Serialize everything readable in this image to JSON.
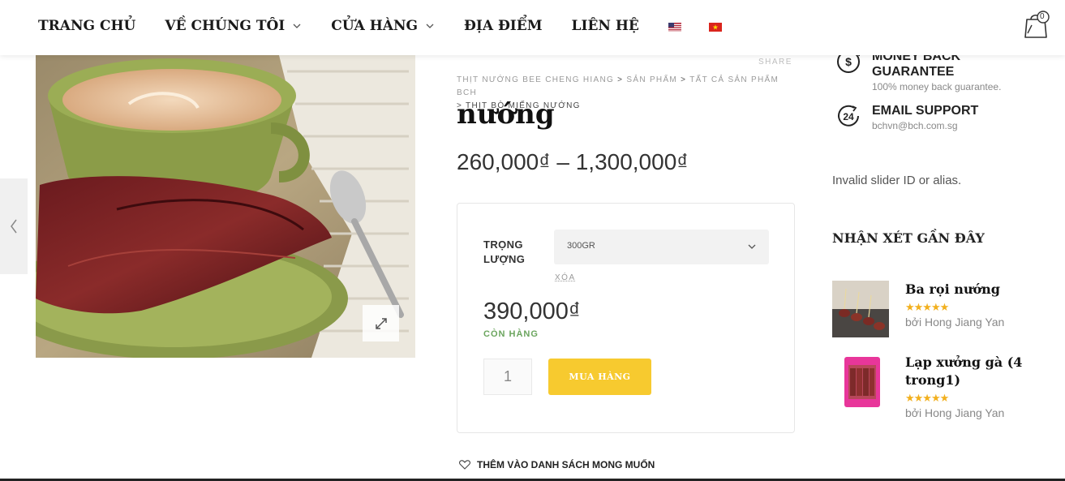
{
  "nav": {
    "items": [
      {
        "label": "TRANG CHỦ",
        "has_dropdown": false
      },
      {
        "label": "VỀ CHÚNG TÔI",
        "has_dropdown": true
      },
      {
        "label": "CỬA HÀNG",
        "has_dropdown": true
      },
      {
        "label": "ĐỊA ĐIỂM",
        "has_dropdown": false
      },
      {
        "label": "LIÊN HỆ",
        "has_dropdown": false
      }
    ],
    "flags": [
      "us-flag-icon",
      "vn-flag-icon"
    ],
    "cart_count": "0"
  },
  "product": {
    "share_label": "SHARE",
    "breadcrumb": [
      "THỊT NƯỚNG BEE CHENG HIANG",
      "SẢN PHẨM",
      "TẤT CẢ SẢN PHẨM BCH",
      "THỊT BÒ MIẾNG NƯỚNG"
    ],
    "breadcrumb_sep": ">",
    "title": "nướng",
    "price_range": "260,000₫ – 1,300,000₫"
  },
  "variation": {
    "attribute_label": "TRỌNG LƯỢNG",
    "selected": "300GR",
    "reset_label": "XÓA",
    "price": "390,000₫",
    "stock": "CÒN HÀNG",
    "quantity": "1",
    "buy_label": "MUA HÀNG"
  },
  "wishlist_label": "THÊM VÀO DANH SÁCH MONG MUỐN",
  "sidebar": {
    "features": [
      {
        "icon": "money-back-icon",
        "title": "MONEY BACK GUARANTEE",
        "desc": "100% money back guarantee."
      },
      {
        "icon": "support-24-icon",
        "title": "EMAIL SUPPORT",
        "desc": "bchvn@bch.com.sg"
      }
    ],
    "slider_message": "Invalid slider ID or alias.",
    "reviews_title": "NHẬN XÉT GẦN ĐÂY",
    "reviews": [
      {
        "name": "Ba rọi nướng",
        "rating": 5,
        "author": "bởi Hong Jiang Yan"
      },
      {
        "name": "Lạp xưởng gà (4 trong1)",
        "rating": 5,
        "author": "bởi Hong Jiang Yan"
      }
    ]
  },
  "colors": {
    "accent_yellow": "#f7ca2f",
    "stock_green": "#6ba55e",
    "star_gold": "#f2b01e"
  }
}
